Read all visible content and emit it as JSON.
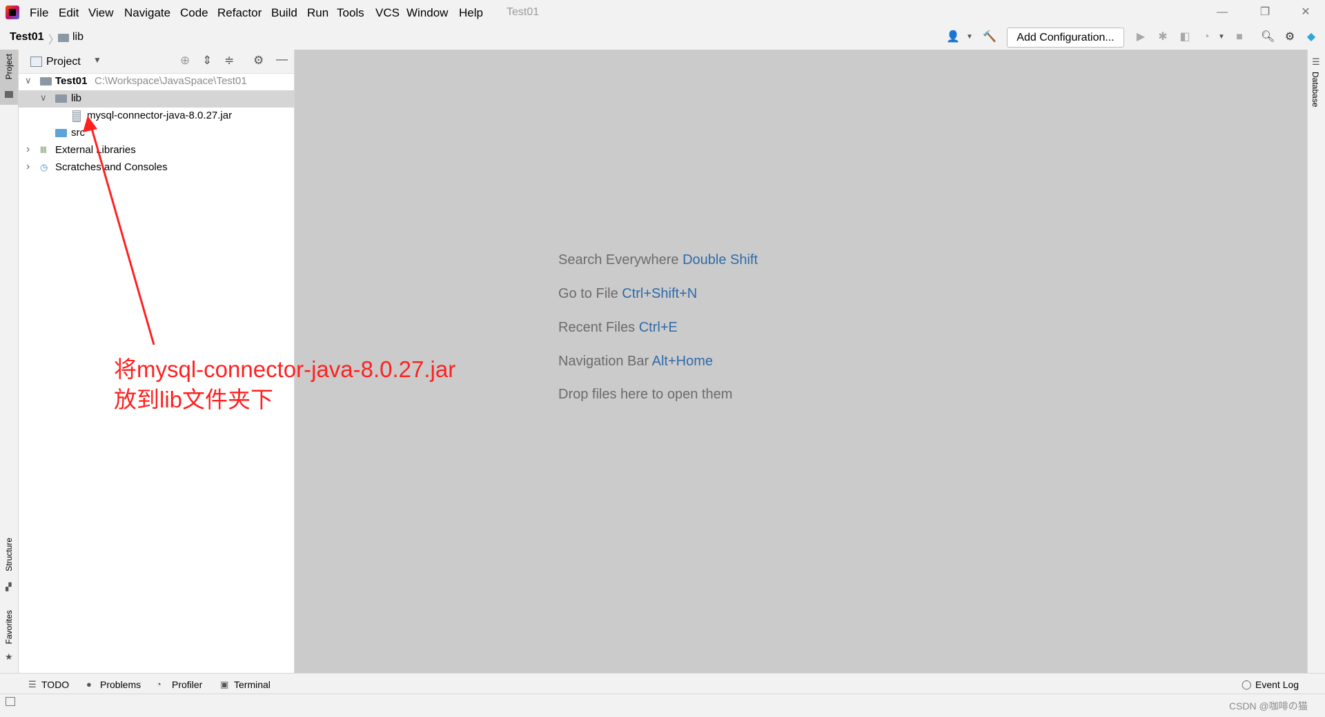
{
  "window": {
    "title": "Test01",
    "menu": [
      "File",
      "Edit",
      "View",
      "Navigate",
      "Code",
      "Refactor",
      "Build",
      "Run",
      "Tools",
      "VCS",
      "Window",
      "Help"
    ],
    "controls": {
      "minimize": "—",
      "restore": "❐",
      "close": "✕"
    }
  },
  "navbar": {
    "breadcrumb_project": "Test01",
    "breadcrumb_sep": "〉",
    "breadcrumb_folder": "lib",
    "add_configuration": "Add Configuration..."
  },
  "left_stripe": {
    "project": "Project",
    "structure": "Structure",
    "favorites": "Favorites"
  },
  "right_stripe": {
    "database": "Database"
  },
  "project_panel": {
    "title": "Project",
    "tree": [
      {
        "label": "Test01",
        "path": "C:\\Workspace\\JavaSpace\\Test01",
        "arrow": "∨"
      },
      {
        "label": "lib",
        "arrow": "∨"
      },
      {
        "label": "mysql-connector-java-8.0.27.jar"
      },
      {
        "label": "src"
      },
      {
        "label": "External Libraries",
        "arrow": "›"
      },
      {
        "label": "Scratches and Consoles",
        "arrow": "›"
      }
    ]
  },
  "editor_hints": [
    {
      "text": "Search Everywhere",
      "key": "Double Shift"
    },
    {
      "text": "Go to File",
      "key": "Ctrl+Shift+N"
    },
    {
      "text": "Recent Files",
      "key": "Ctrl+E"
    },
    {
      "text": "Navigation Bar",
      "key": "Alt+Home"
    },
    {
      "text": "Drop files here to open them",
      "key": ""
    }
  ],
  "annotation": {
    "line1": "将mysql-connector-java-8.0.27.jar",
    "line2": "放到lib文件夹下",
    "color": "#ff2020"
  },
  "bottom_tabs": [
    "TODO",
    "Problems",
    "Profiler",
    "Terminal"
  ],
  "event_log": "Event Log",
  "watermark": "CSDN @咖啡の猫"
}
